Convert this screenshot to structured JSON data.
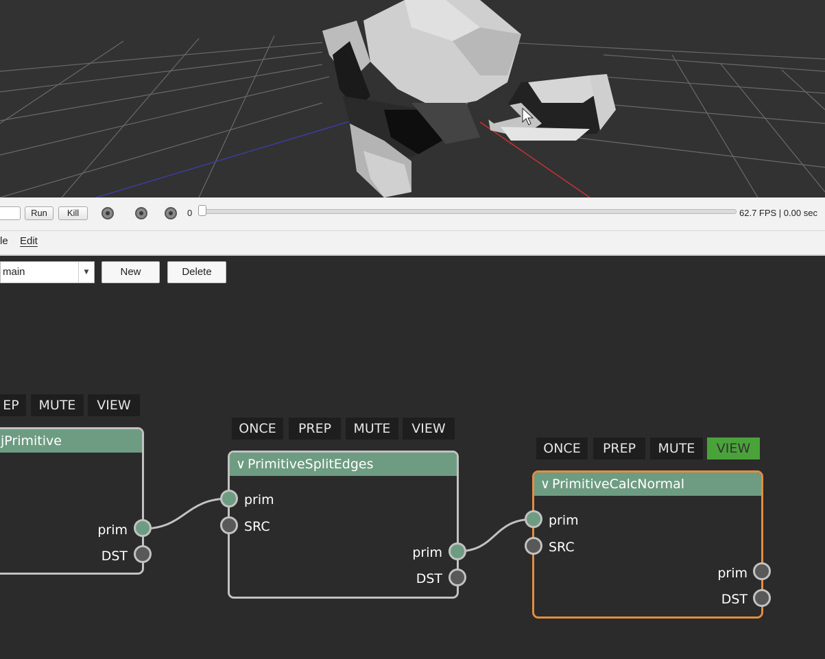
{
  "viewport": {
    "grid_color": "#6a6a6a",
    "axis_x_color": "#c83232",
    "axis_z_color": "#3c3ca0",
    "mesh_color": "#c8c8c8",
    "mouse_cursor_icon": "arrow-cursor-icon"
  },
  "toolbar": {
    "run_label": "Run",
    "kill_label": "Kill",
    "frame_value": "0",
    "fps_text": "62.7 FPS | 0.00 sec",
    "frame_slider_position": 0
  },
  "menubar": {
    "file_label": "le",
    "edit_label": "Edit"
  },
  "graph": {
    "graph_select_value": "main",
    "new_label": "New",
    "delete_label": "Delete",
    "flags": {
      "once": "ONCE",
      "prep": "PREP",
      "mute": "MUTE",
      "view": "VIEW"
    },
    "node_left": {
      "title": "jPrimitive",
      "out_sockets": [
        "prim",
        "DST"
      ],
      "flag_prep_partial": "EP"
    },
    "node_split": {
      "title": "PrimitiveSplitEdges",
      "in_sockets": [
        "prim",
        "SRC"
      ],
      "out_sockets": [
        "prim",
        "DST"
      ]
    },
    "node_calc": {
      "title": "PrimitiveCalcNormal",
      "in_sockets": [
        "prim",
        "SRC"
      ],
      "out_sockets": [
        "prim",
        "DST"
      ],
      "view_active": true
    },
    "colors": {
      "header": "#6e9c82",
      "selected_border": "#e58d3f",
      "view_on": "#4aa33a",
      "link": "#c2c2c2"
    }
  }
}
